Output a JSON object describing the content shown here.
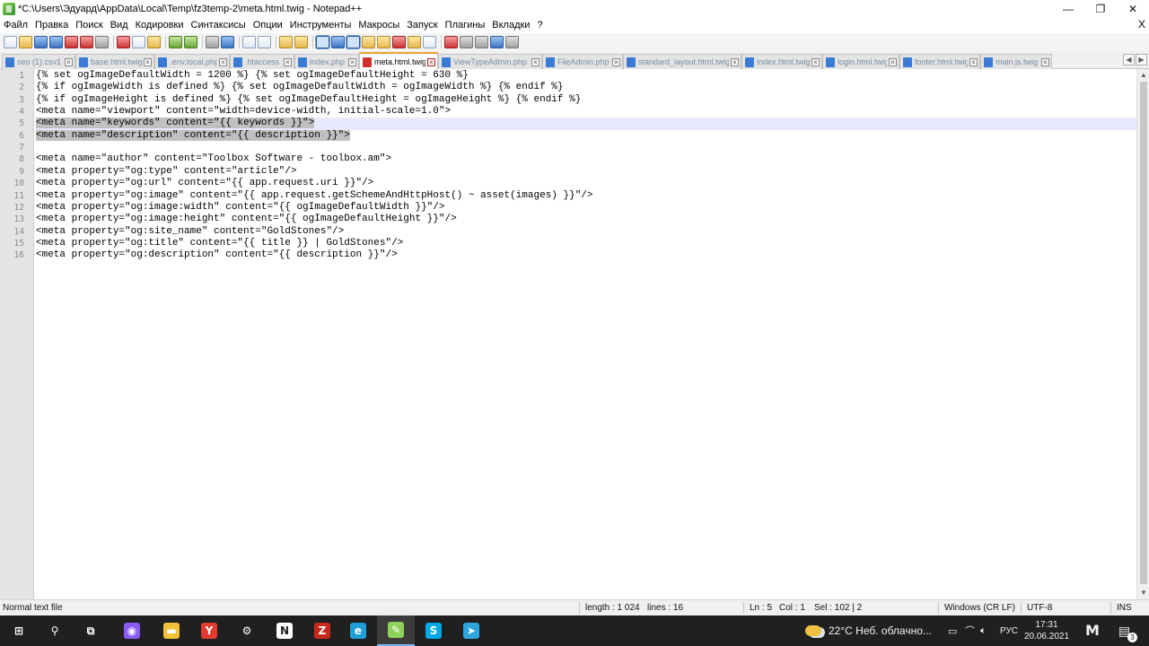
{
  "window": {
    "title": "*C:\\Users\\Эдуард\\AppData\\Local\\Temp\\fz3temp-2\\meta.html.twig - Notepad++",
    "minimize": "—",
    "maximize": "❐",
    "close": "✕"
  },
  "menu": {
    "items": [
      "Файл",
      "Правка",
      "Поиск",
      "Вид",
      "Кодировки",
      "Синтаксисы",
      "Опции",
      "Инструменты",
      "Макросы",
      "Запуск",
      "Плагины",
      "Вкладки",
      "?"
    ],
    "close_doc": "X"
  },
  "tabs": [
    {
      "label": "seo (1).csv1",
      "active": false
    },
    {
      "label": "base.html.twig",
      "active": false
    },
    {
      "label": ".env.local.php",
      "active": false
    },
    {
      "label": ".htaccess",
      "active": false
    },
    {
      "label": "index.php",
      "active": false
    },
    {
      "label": "meta.html.twig",
      "active": true
    },
    {
      "label": "ViewTypeAdmin.php",
      "active": false
    },
    {
      "label": "FileAdmin.php",
      "active": false
    },
    {
      "label": "standard_layout.html.twig",
      "active": false
    },
    {
      "label": "index.html.twig",
      "active": false
    },
    {
      "label": "login.html.twig",
      "active": false
    },
    {
      "label": "footer.html.twig",
      "active": false
    },
    {
      "label": "main.js.twig",
      "active": false
    }
  ],
  "tab_close_glyph": "×",
  "tab_nav": {
    "left": "◀",
    "right": "▶"
  },
  "editor": {
    "lines": [
      "{% set ogImageDefaultWidth = 1200 %} {% set ogImageDefaultHeight = 630 %}",
      "{% if ogImageWidth is defined %} {% set ogImageDefaultWidth = ogImageWidth %} {% endif %}",
      "{% if ogImageHeight is defined %} {% set ogImageDefaultHeight = ogImageHeight %} {% endif %}",
      "<meta name=\"viewport\" content=\"width=device-width, initial-scale=1.0\">",
      "<meta name=\"keywords\" content=\"{{ keywords }}\">",
      "<meta name=\"description\" content=\"{{ description }}\">",
      "",
      "<meta name=\"author\" content=\"Toolbox Software - toolbox.am\">",
      "<meta property=\"og:type\" content=\"article\"/>",
      "<meta property=\"og:url\" content=\"{{ app.request.uri }}\"/>",
      "<meta property=\"og:image\" content=\"{{ app.request.getSchemeAndHttpHost() ~ asset(images) }}\"/>",
      "<meta property=\"og:image:width\" content=\"{{ ogImageDefaultWidth }}\"/>",
      "<meta property=\"og:image:height\" content=\"{{ ogImageDefaultHeight }}\"/>",
      "<meta property=\"og:site_name\" content=\"GoldStones\"/>",
      "<meta property=\"og:title\" content=\"{{ title }} | GoldStones\"/>",
      "<meta property=\"og:description\" content=\"{{ description }}\"/>"
    ],
    "current_line": 5,
    "selected_lines": [
      5,
      6
    ]
  },
  "status": {
    "file_type": "Normal text file",
    "length": "length : 1 024",
    "lines": "lines : 16",
    "ln": "Ln : 5",
    "col": "Col : 1",
    "sel": "Sel : 102 | 2",
    "eol": "Windows (CR LF)",
    "encoding": "UTF-8",
    "mode": "INS"
  },
  "taskbar": {
    "weather": "22°C  Неб. облачно...",
    "language": "РУС",
    "time": "17:31",
    "date": "20.06.2021",
    "notifications": "3",
    "apps": [
      {
        "name": "start",
        "glyph": "⊞",
        "color": "#202020"
      },
      {
        "name": "search",
        "glyph": "⚲",
        "color": "#202020"
      },
      {
        "name": "task-view",
        "glyph": "⧉",
        "color": "#202020"
      },
      {
        "name": "alice",
        "glyph": "◉",
        "color": "#8a5cf5"
      },
      {
        "name": "file-explorer",
        "glyph": "▬",
        "color": "#f2c23a"
      },
      {
        "name": "yandex-browser",
        "glyph": "Y",
        "color": "#e23a2e"
      },
      {
        "name": "settings",
        "glyph": "⚙",
        "color": "#202020"
      },
      {
        "name": "notion",
        "glyph": "N",
        "color": "#ffffff"
      },
      {
        "name": "filezilla",
        "glyph": "Z",
        "color": "#c8291d"
      },
      {
        "name": "edge",
        "glyph": "e",
        "color": "#1f9fd8"
      },
      {
        "name": "notepad-plus-plus",
        "glyph": "✎",
        "color": "#8fd35a"
      },
      {
        "name": "skype",
        "glyph": "S",
        "color": "#00a8e8"
      },
      {
        "name": "telegram",
        "glyph": "➤",
        "color": "#2ea5dd"
      }
    ]
  }
}
